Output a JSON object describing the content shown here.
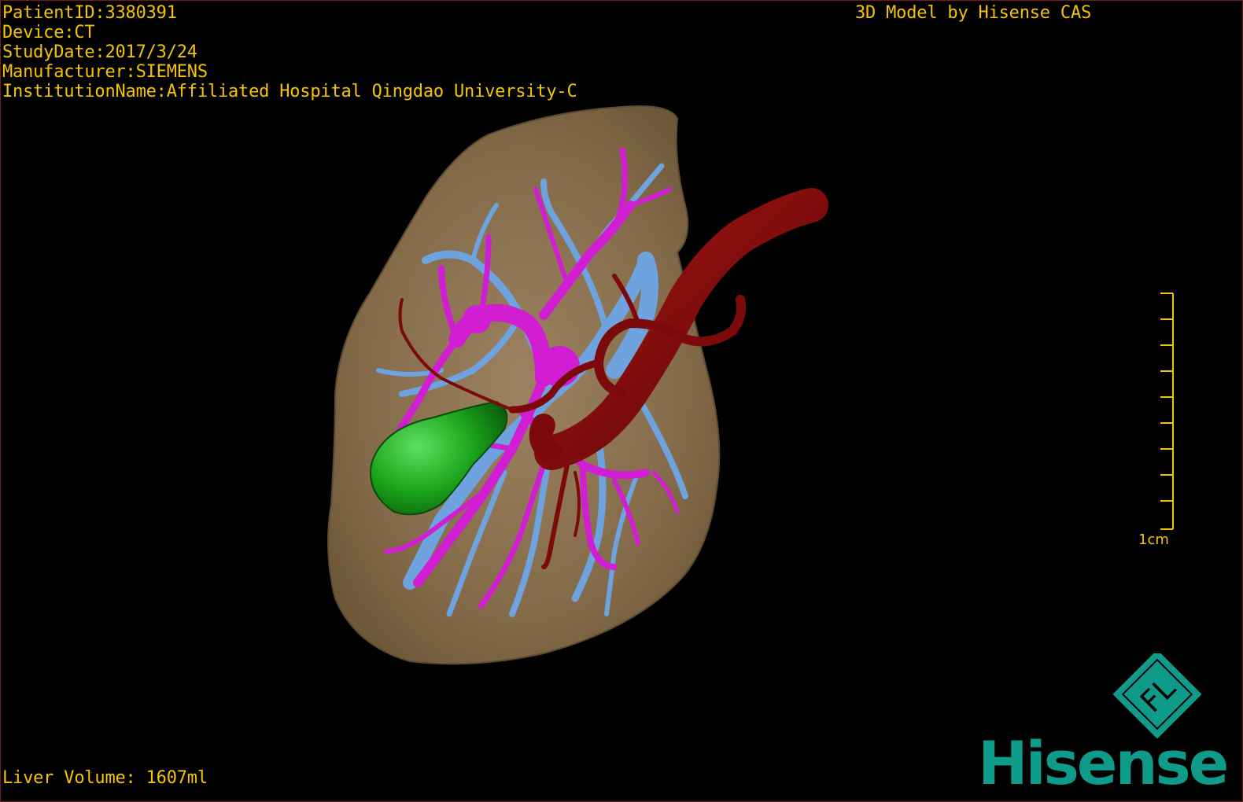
{
  "header": {
    "patient_id": "PatientID:3380391",
    "device": "Device:CT",
    "study_date": "StudyDate:2017/3/24",
    "manufacturer": "Manufacturer:SIEMENS",
    "institution": "InstitutionName:Affiliated Hospital Qingdao University-C"
  },
  "credit": "3D Model by Hisense CAS",
  "footer": {
    "liver_volume": "Liver Volume: 1607ml"
  },
  "scale": {
    "label": "1cm"
  },
  "logo": {
    "brand": "Hisense",
    "badge_text": "FL"
  },
  "colors": {
    "overlay_text": "#f5c400",
    "liver": "#8c7350",
    "portal_vein": "#d21ed2",
    "hepatic_vein": "#6ea3e0",
    "artery": "#7d0a0a",
    "gallbladder": "#1fa21f",
    "brand": "#0f9b8a"
  }
}
